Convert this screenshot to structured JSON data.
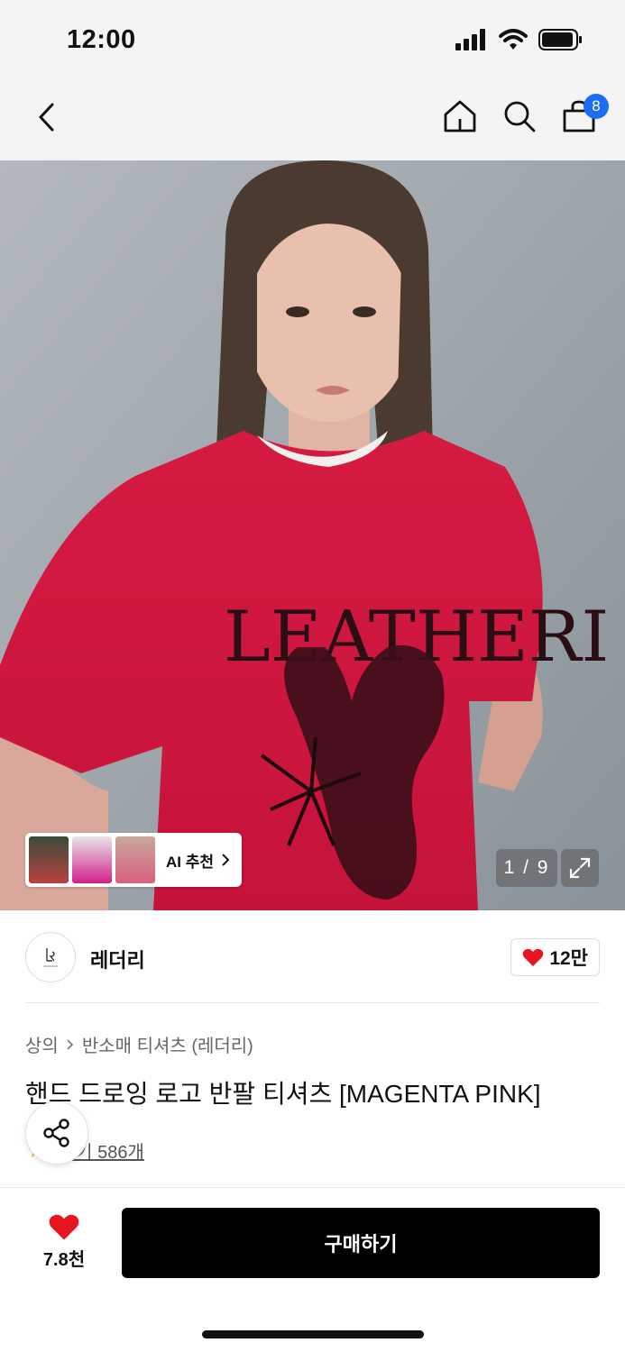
{
  "status_bar": {
    "time": "12:00"
  },
  "nav": {
    "icons": [
      "back-icon",
      "home-icon",
      "search-icon",
      "shopping-bag-icon"
    ],
    "cart_count": "8"
  },
  "hero": {
    "image_counter": "1 / 9",
    "ai_recommend_label": "AI 추천",
    "shirt_print_text": "LEATHERI"
  },
  "brand": {
    "name": "레더리",
    "like_count": "12만"
  },
  "breadcrumb": {
    "category": "상의",
    "subcategory": "반소매 티셔츠 (레더리)"
  },
  "product": {
    "title": "핸드 드로잉 로고 반팔 티셔츠 [MAGENTA PINK]",
    "review_label": "후기 586개"
  },
  "bottom_bar": {
    "wish_count": "7.8천",
    "buy_label": "구매하기"
  },
  "colors": {
    "accent_blue": "#1b6ef3",
    "heart_red": "#e8141f",
    "shirt_magenta": "#d8183f",
    "buy_button": "#000000"
  }
}
